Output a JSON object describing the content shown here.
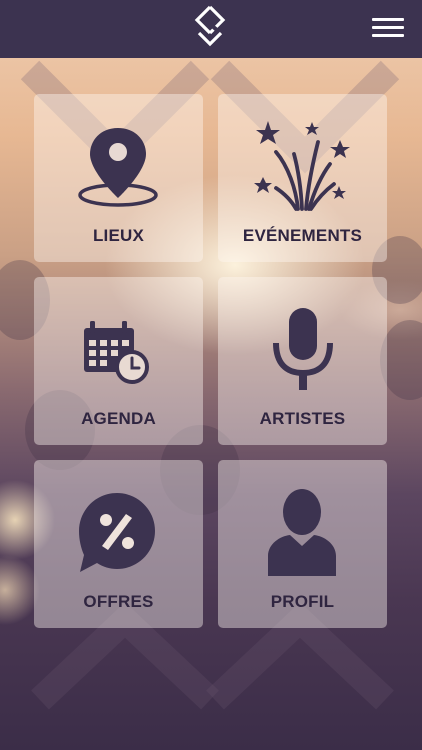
{
  "colors": {
    "topbar": "#3c3350",
    "icon": "#3c3350",
    "label": "#2f2540"
  },
  "header": {
    "logo_icon": "diamond-chevron-logo",
    "menu_icon": "hamburger-icon"
  },
  "tiles": [
    {
      "label": "LIEUX",
      "icon": "map-pin-icon"
    },
    {
      "label": "EVÉNEMENTS",
      "icon": "fireworks-icon"
    },
    {
      "label": "AGENDA",
      "icon": "calendar-clock-icon"
    },
    {
      "label": "ARTISTES",
      "icon": "microphone-icon"
    },
    {
      "label": "OFFRES",
      "icon": "percent-bubble-icon"
    },
    {
      "label": "PROFIL",
      "icon": "user-icon"
    }
  ]
}
